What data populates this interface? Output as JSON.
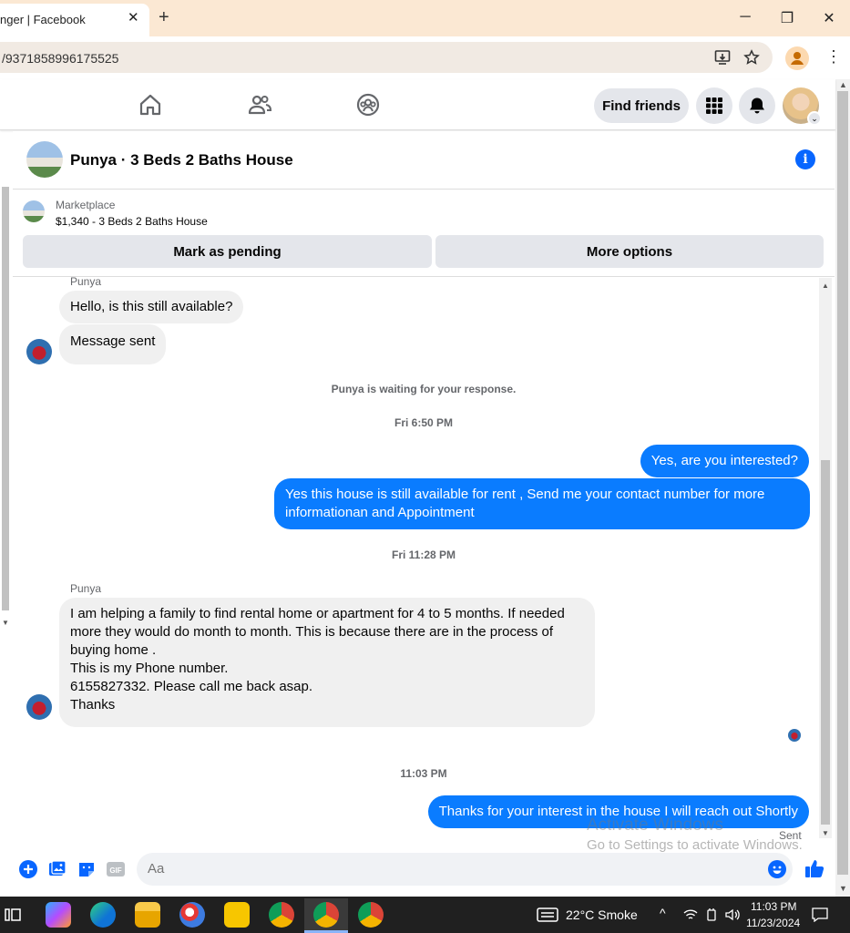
{
  "browser": {
    "tab_title": "nger | Facebook",
    "tab_close": "✕",
    "new_tab": "+",
    "url": "/9371858996175525",
    "window_controls": [
      "─",
      "❐",
      "✕"
    ]
  },
  "fb_nav": {
    "find_friends": "Find friends"
  },
  "conversation": {
    "title": "Punya · 3 Beds 2 Baths House",
    "info": "i"
  },
  "marketplace": {
    "label": "Marketplace",
    "item": "$1,340 - 3 Beds 2 Baths House",
    "mark_pending": "Mark as pending",
    "more_options": "More options"
  },
  "messages": {
    "sender_top": "Punya",
    "msg1": "Hello, is this still available?",
    "msg2": "Message sent",
    "waiting_note": "Punya is waiting for your response.",
    "time1": "Fri 6:50 PM",
    "out1": "Yes, are you interested?",
    "out2": "Yes this house is still available for rent , Send me your contact number for more informationan and Appointment",
    "time2": "Fri 11:28 PM",
    "sender2": "Punya",
    "long_msg": [
      "I am helping a family to find rental home or apartment for 4 to 5 months. If needed more they would do month to month. This is because there are in the process of buying home .",
      "This is my Phone number.",
      "6155827332. Please call me back asap.",
      "Thanks"
    ],
    "time3": "11:03 PM",
    "out3": "Thanks for your interest in the house I will reach out Shortly",
    "sent_status": "Sent"
  },
  "composer": {
    "placeholder": "Aa"
  },
  "watermark": {
    "line1": "Activate Windows",
    "line2": "Go to Settings to activate Windows."
  },
  "taskbar": {
    "weather": "22°C  Smoke",
    "time": "11:03 PM",
    "date": "11/23/2024"
  },
  "colors": {
    "messenger_blue": "#0a7cff",
    "fb_blue": "#0866ff",
    "tabbar_bg": "#fbe8d3",
    "taskbar_bg": "#202020"
  }
}
